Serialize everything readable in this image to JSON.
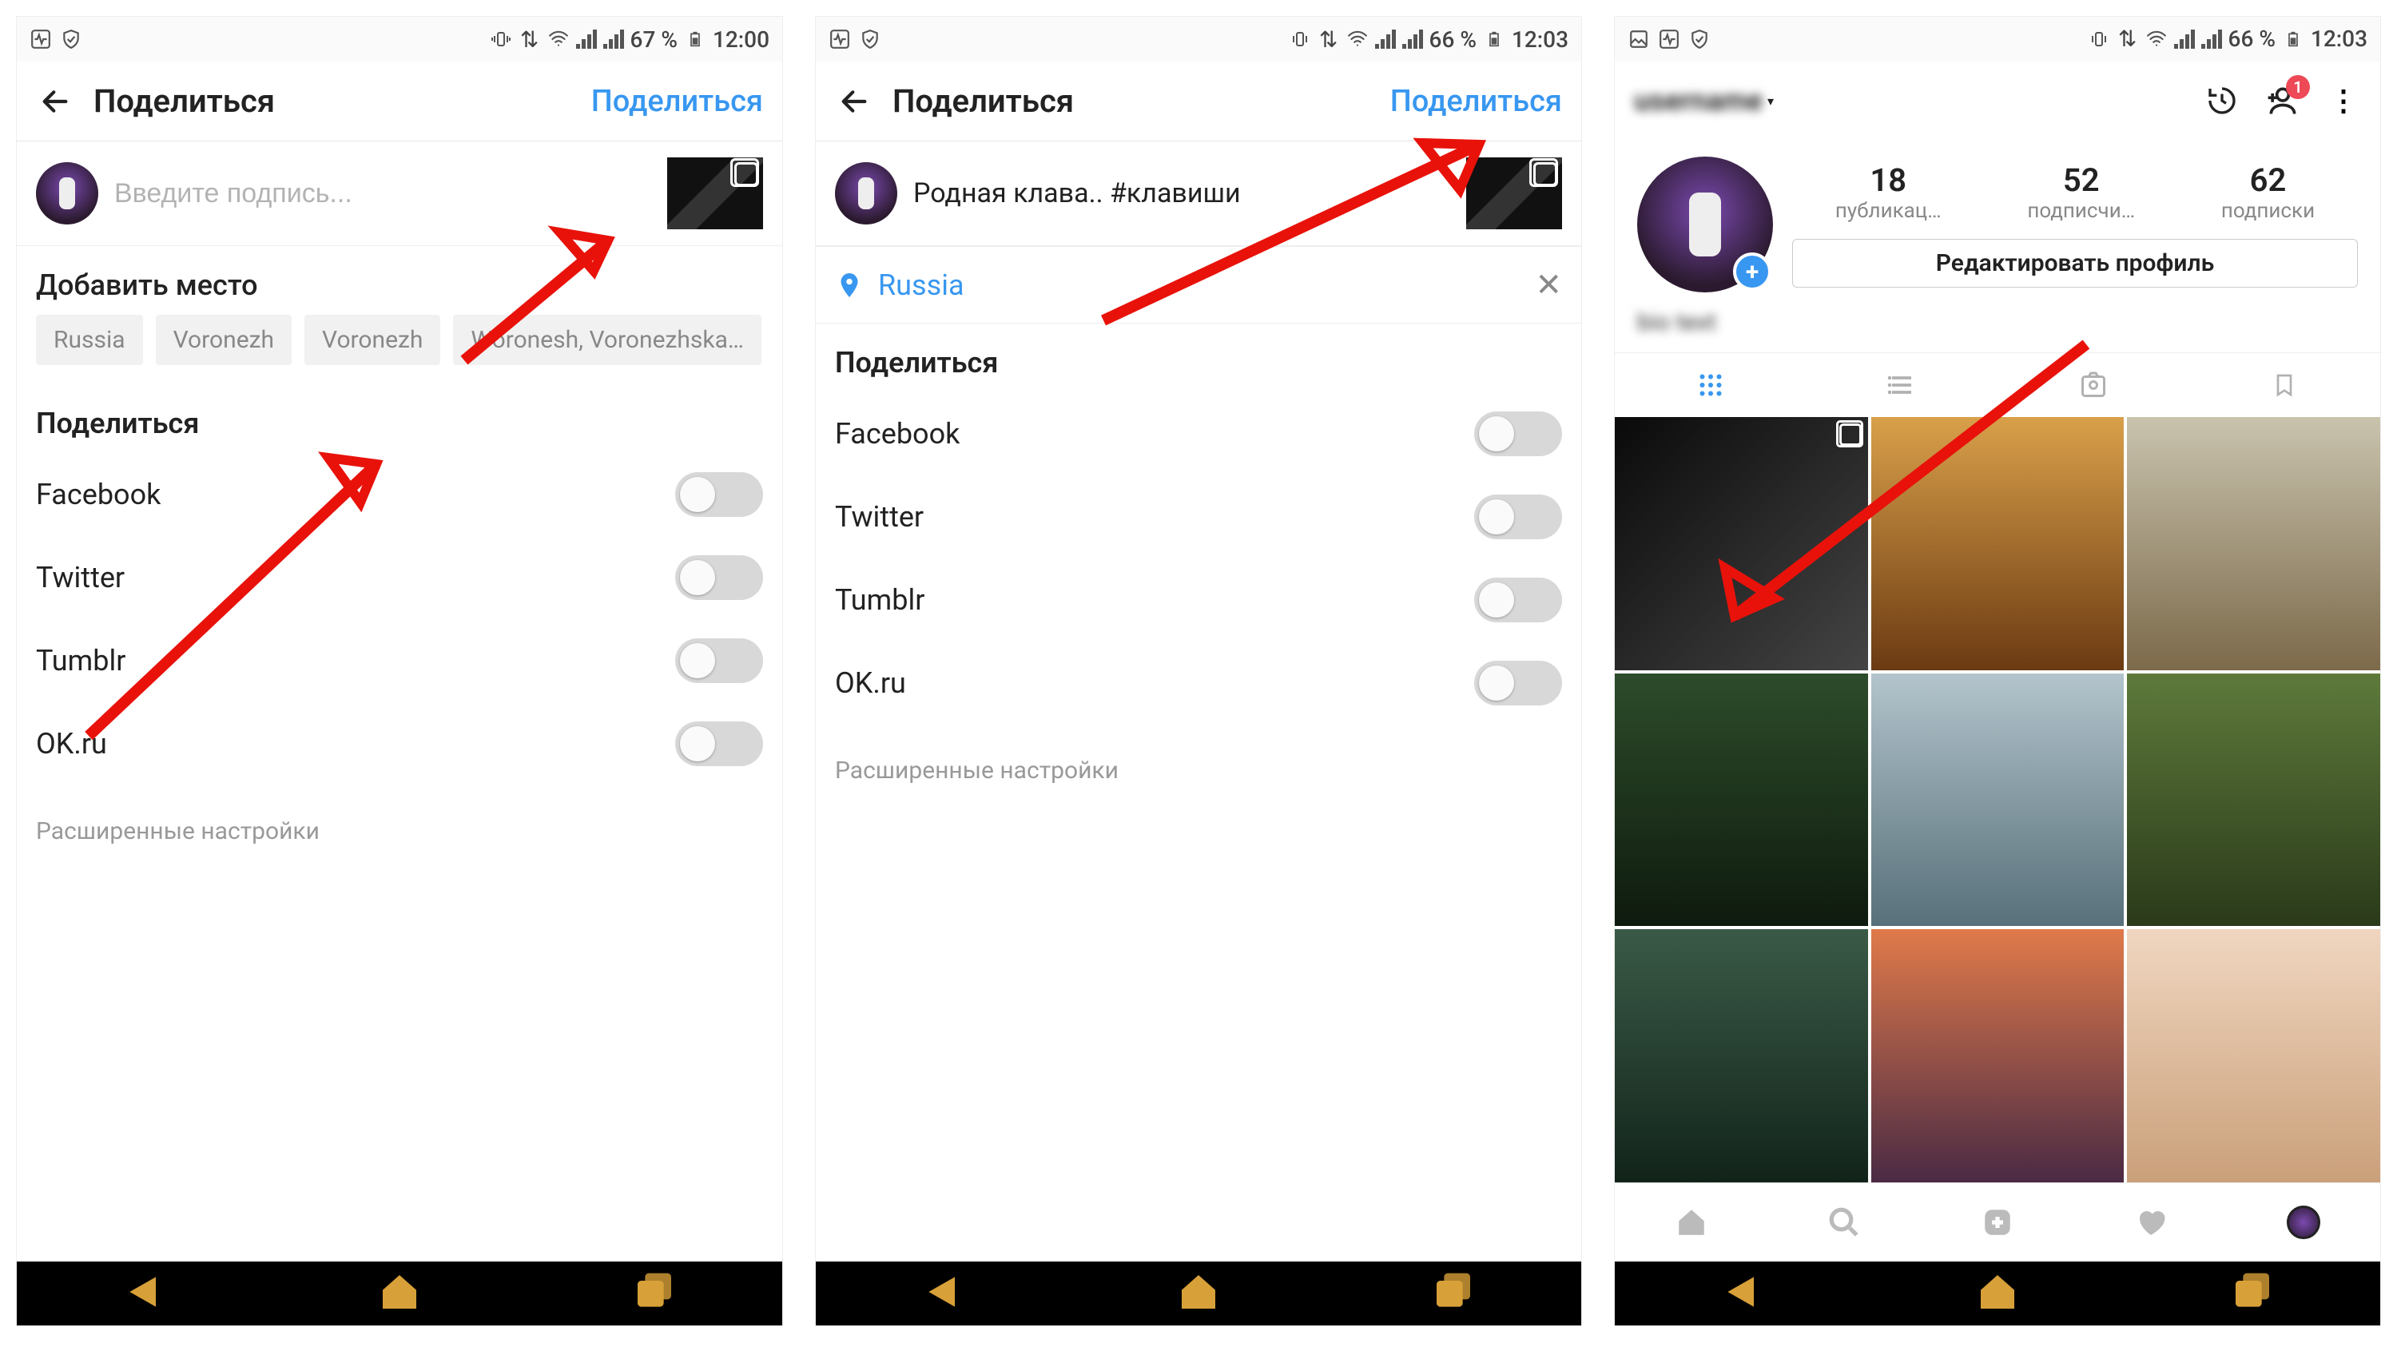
{
  "status": {
    "battery_1": "67 %",
    "battery_2": "66 %",
    "battery_3": "66 %",
    "time_1": "12:00",
    "time_2": "12:03",
    "time_3": "12:03"
  },
  "screen1": {
    "header_title": "Поделиться",
    "header_action": "Поделиться",
    "caption_placeholder": "Введите подпись...",
    "add_place": "Добавить место",
    "chips": [
      "Russia",
      "Voronezh",
      "Voronezh",
      "Woronesh, Voronezhska…"
    ],
    "share_heading": "Поделиться",
    "share_targets": [
      "Facebook",
      "Twitter",
      "Tumblr",
      "OK.ru"
    ],
    "advanced": "Расширенные настройки"
  },
  "screen2": {
    "header_title": "Поделиться",
    "header_action": "Поделиться",
    "caption_text": "Родная клава.. #клавиши",
    "location": "Russia",
    "share_heading": "Поделиться",
    "share_targets": [
      "Facebook",
      "Twitter",
      "Tumblr",
      "OK.ru"
    ],
    "advanced": "Расширенные настройки"
  },
  "screen3": {
    "username": "username",
    "notif_badge": "1",
    "stats": {
      "posts_n": "18",
      "posts_l": "публикац…",
      "followers_n": "52",
      "followers_l": "подписчи…",
      "following_n": "62",
      "following_l": "подписки"
    },
    "edit_profile": "Редактировать профиль",
    "bio": "bio text"
  }
}
